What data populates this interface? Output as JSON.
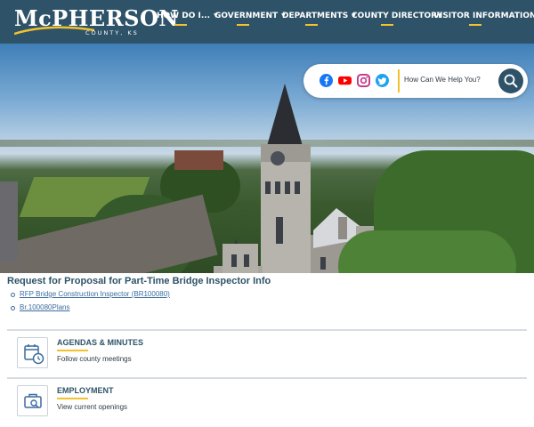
{
  "brand": {
    "name": "McPHERSON",
    "subtitle": "COUNTY, KS",
    "primary_color": "#2e5368",
    "accent_color": "#f2c22e"
  },
  "nav": {
    "items": [
      {
        "label": "HOW DO I...",
        "has_caret": true
      },
      {
        "label": "GOVERNMENT",
        "has_caret": true
      },
      {
        "label": "DEPARTMENTS",
        "has_caret": true
      },
      {
        "label": "COUNTY DIRECTORY",
        "has_caret": false
      },
      {
        "label": "VISITOR INFORMATION",
        "has_caret": true
      }
    ],
    "caret_glyph": "▼"
  },
  "social": {
    "icons": [
      "facebook-icon",
      "youtube-icon",
      "instagram-icon",
      "twitter-icon"
    ],
    "colors": {
      "facebook": "#1877f2",
      "youtube": "#ff0000",
      "instagram": "#c13584",
      "twitter": "#1da1f2"
    }
  },
  "search": {
    "prompt": "How Can We Help You?",
    "icon": "search-icon"
  },
  "hero": {
    "image": "aerial-courthouse-photo"
  },
  "notice": {
    "title": "Request for Proposal for Part-Time Bridge Inspector Info",
    "links": [
      "RFP Bridge Construction Inspector (BR100080)",
      "Br.100080Plans"
    ]
  },
  "cards": [
    {
      "title": "AGENDAS & MINUTES",
      "description": "Follow county meetings",
      "icon": "calendar-clock-icon"
    },
    {
      "title": "EMPLOYMENT",
      "description": "View current openings",
      "icon": "briefcase-search-icon"
    }
  ]
}
